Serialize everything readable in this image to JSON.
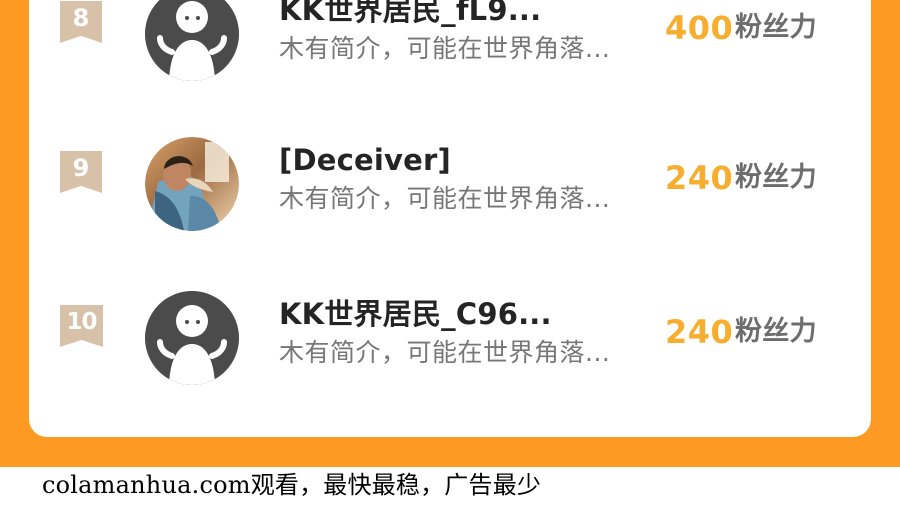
{
  "ranking": {
    "unit_label": "粉丝力",
    "entries": [
      {
        "rank": "8",
        "name": "KK世界居民_fL9...",
        "bio": "木有简介，可能在世界角落...",
        "score": "400",
        "avatar_icon": "default-user-avatar-icon"
      },
      {
        "rank": "9",
        "name": "[Deceiver]",
        "bio": "木有简介，可能在世界角落...",
        "score": "240",
        "avatar_icon": "user-photo-avatar"
      },
      {
        "rank": "10",
        "name": "KK世界居民_C96...",
        "bio": "木有简介，可能在世界角落...",
        "score": "240",
        "avatar_icon": "default-user-avatar-icon"
      }
    ]
  },
  "footer": {
    "text": "colamanhua.com观看，最快最稳，广告最少"
  },
  "colors": {
    "background_orange": "#fd9a23",
    "rank_badge": "#d8c1a9",
    "score": "#f7ad2d",
    "name": "#242424",
    "bio": "#777777",
    "default_avatar": "#4b4b4c"
  }
}
